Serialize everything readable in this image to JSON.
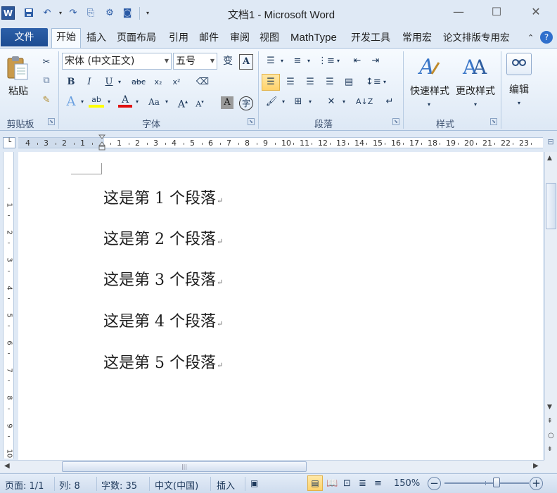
{
  "window": {
    "app_icon": "W",
    "title": "文档1 - Microsoft Word",
    "minimize": "—",
    "maximize": "☐",
    "close": "✕"
  },
  "qat": {
    "save_icon": "save-icon",
    "undo_icon": "undo-icon",
    "redo_icon": "redo-icon"
  },
  "tabs": {
    "file": "文件",
    "items": [
      "开始",
      "插入",
      "页面布局",
      "引用",
      "邮件",
      "审阅",
      "视图",
      "MathType",
      "开发工具",
      "常用宏",
      "论文排版专用宏"
    ],
    "active": "开始"
  },
  "ribbon": {
    "clipboard": {
      "paste": "粘贴",
      "label": "剪贴板"
    },
    "font": {
      "name": "宋体 (中文正文)",
      "size": "五号",
      "label": "字体"
    },
    "paragraph": {
      "label": "段落"
    },
    "styles": {
      "quick_styles": "快速样式",
      "change_styles": "更改样式",
      "label": "样式"
    },
    "editing": {
      "label": "编辑"
    }
  },
  "ruler": {
    "numbers": [
      "4",
      "3",
      "2",
      "1",
      "",
      "1",
      "2",
      "3",
      "4",
      "5",
      "6",
      "7",
      "8",
      "9",
      "10",
      "11",
      "12",
      "13",
      "14",
      "15",
      "16",
      "17",
      "18",
      "19",
      "20",
      "21",
      "22",
      "23"
    ],
    "vertical": [
      "1",
      "2",
      "3",
      "4",
      "5",
      "6",
      "7",
      "8",
      "9",
      "10"
    ]
  },
  "document": {
    "paragraphs": [
      "这是第 1 个段落",
      "这是第 2 个段落",
      "这是第 3 个段落",
      "这是第 4 个段落",
      "这是第 5 个段落"
    ],
    "para_mark": "↵"
  },
  "status": {
    "page": "页面: 1/1",
    "column": "列: 8",
    "words": "字数: 35",
    "language": "中文(中国)",
    "mode": "插入",
    "zoom": "150%",
    "zoom_fraction": 0.62
  }
}
